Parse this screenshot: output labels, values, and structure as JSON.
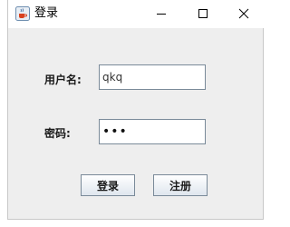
{
  "window": {
    "title": "登录",
    "app_icon": "java-cup-icon",
    "controls": {
      "minimize_icon": "minimize-icon",
      "maximize_icon": "maximize-icon",
      "close_icon": "close-icon"
    }
  },
  "form": {
    "username_label": "用户名:",
    "username_value": "qkq",
    "password_label": "密码:",
    "password_value": "•••"
  },
  "buttons": {
    "login_label": "登录",
    "register_label": "注册"
  },
  "colors": {
    "window_background": "#eeeeee",
    "titlebar_background": "#ffffff",
    "field_border": "#7a8a99"
  }
}
